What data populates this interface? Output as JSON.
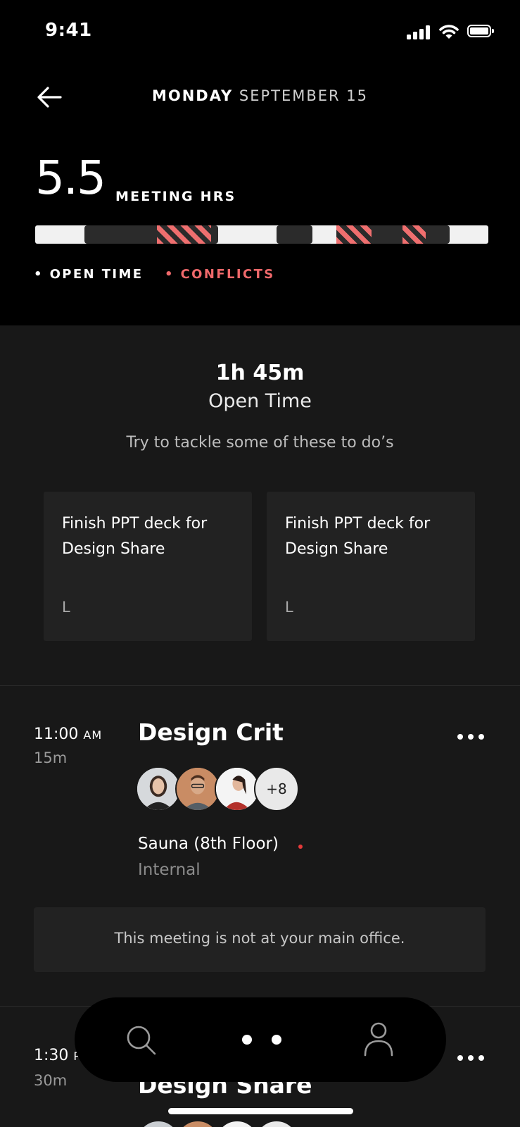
{
  "status_bar": {
    "time": "9:41"
  },
  "header": {
    "day": "MONDAY",
    "date_rest": "SEPTEMBER 15",
    "meeting_hours": "5.5",
    "meeting_hours_label": "MEETING HRS",
    "legend_open": "• OPEN TIME",
    "legend_conflicts": "• CONFLICTS",
    "colors": {
      "open": "#f1f1f1",
      "busy": "#2b2b2b",
      "conflict": "#ef6f6f"
    }
  },
  "open_time": {
    "duration": "1h 45m",
    "label": "Open Time",
    "suggestion": "Try to tackle some of these to do’s",
    "todos": [
      {
        "title": "Finish PPT deck for Design Share",
        "size": "L"
      },
      {
        "title": "Finish PPT deck for Design Share",
        "size": "L"
      }
    ]
  },
  "meetings": [
    {
      "time": "11:00",
      "ampm": "AM",
      "duration": "15m",
      "title": "Design Crit",
      "attendees_more": "+8",
      "room": "Sauna (8th Floor)",
      "type": "Internal",
      "notice": "This meeting is not at your main office."
    },
    {
      "time": "1:30",
      "ampm": "P",
      "duration": "30m",
      "title": "Design Share"
    }
  ],
  "icons": {
    "back": "arrow-left-icon",
    "more": "more-horizontal-icon",
    "search": "search-icon",
    "profile": "user-icon"
  }
}
